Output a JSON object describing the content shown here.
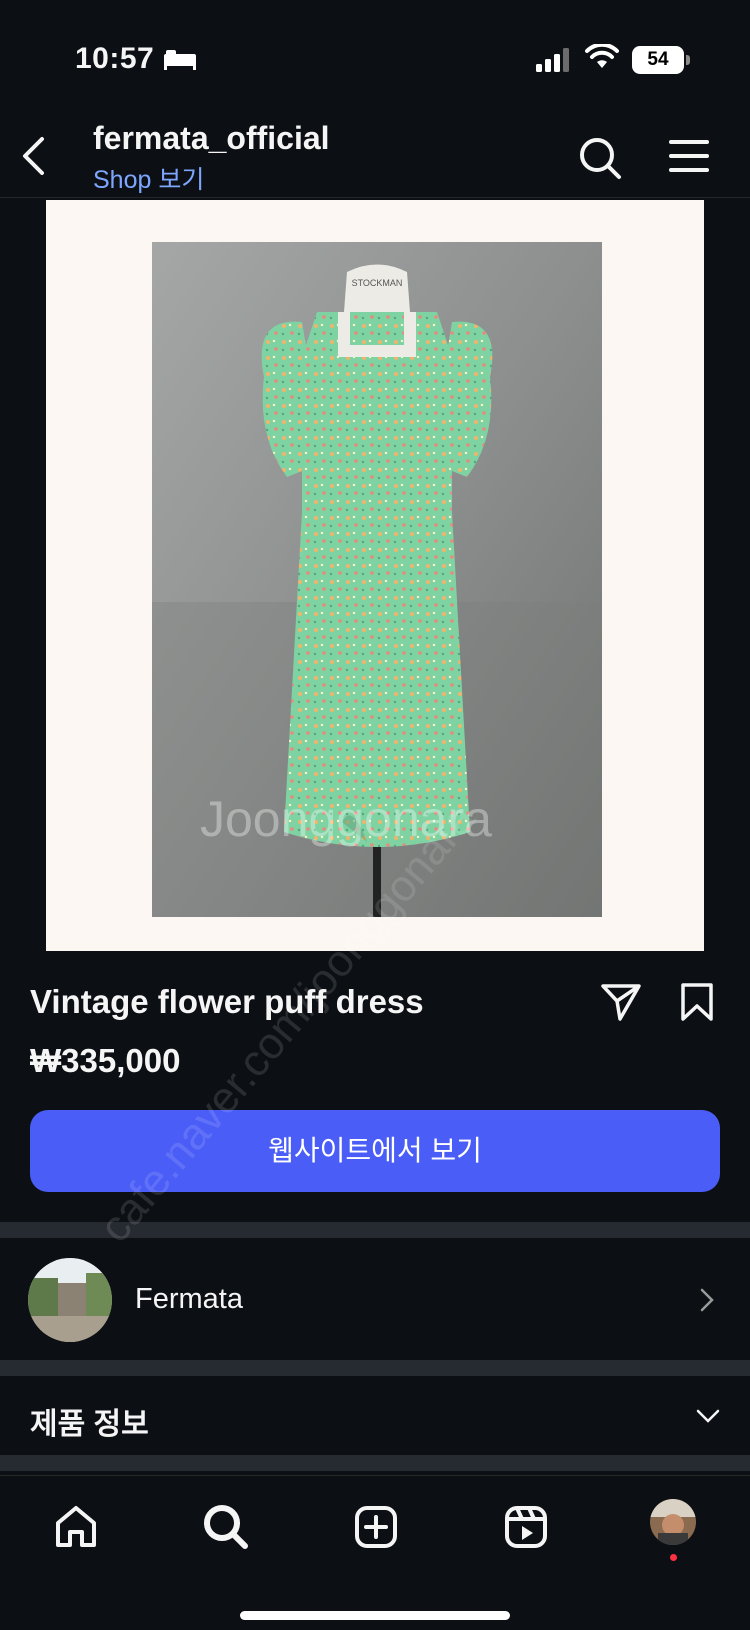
{
  "status_bar": {
    "time": "10:57",
    "battery": "54"
  },
  "header": {
    "account": "fermata_official",
    "shop_link": "Shop 보기"
  },
  "product": {
    "title": "Vintage flower puff dress",
    "price": "₩335,000",
    "cta": "웹사이트에서 보기",
    "photo_label": "STOCKMAN"
  },
  "shop": {
    "name": "Fermata"
  },
  "info": {
    "label": "제품 정보"
  },
  "watermark": {
    "brand": "Joonggonara",
    "url": "cafe.naver.com/joonggonara"
  },
  "colors": {
    "accent": "#4a5ef7",
    "link": "#7ea6ff",
    "background": "#0c1014",
    "notification": "#ff3040"
  },
  "icons": [
    "back-icon",
    "search-icon",
    "menu-icon",
    "share-icon",
    "bookmark-icon",
    "chevron-right-icon",
    "chevron-down-icon",
    "home-icon",
    "explore-icon",
    "create-icon",
    "reels-icon"
  ]
}
